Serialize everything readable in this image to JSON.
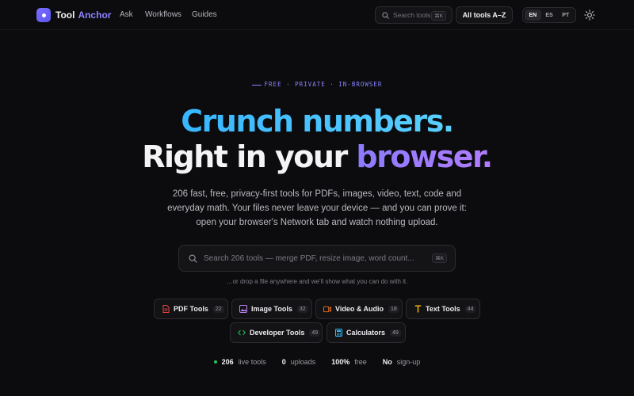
{
  "brand": {
    "word1": "Tool",
    "word2": "Anchor",
    "icon": "anchor-dot-icon"
  },
  "nav": {
    "items": [
      "Ask",
      "Workflows",
      "Guides"
    ]
  },
  "header_search": {
    "placeholder": "Search tools",
    "shortcut": "⌘K"
  },
  "all_tools_label": "All tools A–Z",
  "languages": {
    "options": [
      "EN",
      "ES",
      "PT"
    ],
    "selected": "EN"
  },
  "theme_toggle_icon": "sun-icon",
  "hero": {
    "eyebrow": "FREE · PRIVATE · IN-BROWSER",
    "line1": "Crunch numbers.",
    "line2_plain": "Right in your ",
    "line2_accent": "browser.",
    "subtitle": "206 fast, free, privacy-first tools for PDFs, images, video, text, code and everyday math. Your files never leave your device — and you can prove it: open your browser's Network tab and watch nothing upload."
  },
  "main_search": {
    "placeholder": "Search 206 tools — merge PDF, resize image, word count...",
    "shortcut": "⌘K",
    "drop_hint": "…or drop a file anywhere and we'll show what you can do with it."
  },
  "categories": [
    {
      "label": "PDF Tools",
      "count": "22",
      "icon": "pdf-file-icon",
      "color": "#ef4444"
    },
    {
      "label": "Image Tools",
      "count": "32",
      "icon": "image-icon",
      "color": "#c084fc"
    },
    {
      "label": "Video & Audio",
      "count": "18",
      "icon": "video-icon",
      "color": "#f97316"
    },
    {
      "label": "Text Tools",
      "count": "44",
      "icon": "text-t-icon",
      "color": "#eab308"
    },
    {
      "label": "Developer Tools",
      "count": "49",
      "icon": "code-brackets-icon",
      "color": "#22c55e"
    },
    {
      "label": "Calculators",
      "count": "49",
      "icon": "calculator-icon",
      "color": "#38bdf8"
    }
  ],
  "stats": [
    {
      "value": "206",
      "label": "live tools"
    },
    {
      "value": "0",
      "label": "uploads"
    },
    {
      "value": "100%",
      "label": "free"
    },
    {
      "value": "No",
      "label": "sign-up"
    }
  ],
  "colors": {
    "background": "#0c0c0e",
    "accent": "#8a84ff",
    "blue": "#38b6ff",
    "live": "#22c55e"
  }
}
